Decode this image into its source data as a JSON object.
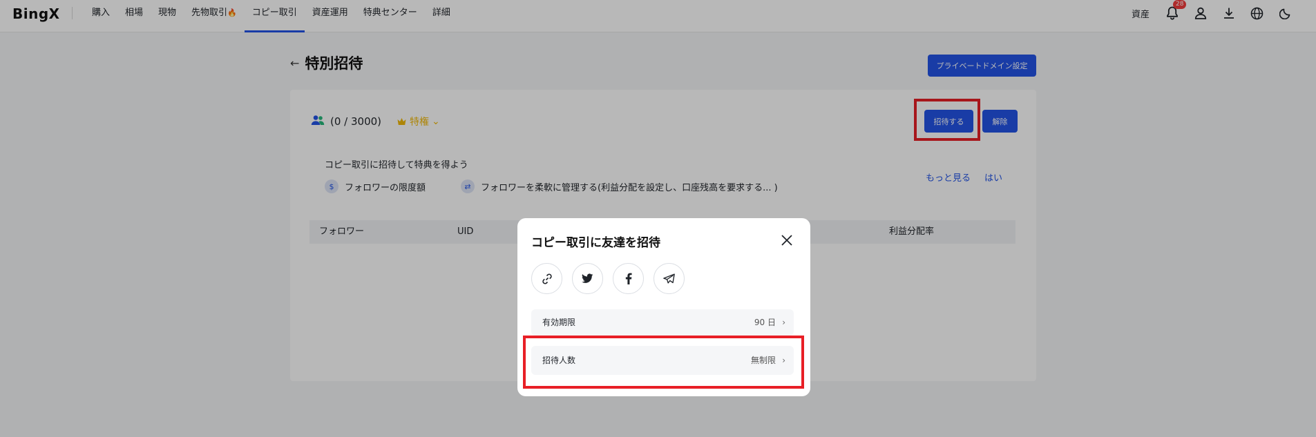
{
  "header": {
    "logo_text": "BingX",
    "nav": [
      {
        "label": "購入"
      },
      {
        "label": "相場"
      },
      {
        "label": "現物"
      },
      {
        "label": "先物取引"
      },
      {
        "label": "コピー取引",
        "active": true
      },
      {
        "label": "資産運用"
      },
      {
        "label": "特典センター"
      },
      {
        "label": "詳細"
      }
    ],
    "assets_label": "資産",
    "notification_count": "28",
    "icons": [
      "bell-icon",
      "user-icon",
      "download-icon",
      "globe-icon",
      "moon-icon"
    ]
  },
  "page": {
    "title": "特別招待",
    "domain_button": "プライベートドメイン設定",
    "count_text": "(0 / 3000)",
    "privilege_label": "特権",
    "invite_button": "招待する",
    "release_button": "解除",
    "promo_title": "コピー取引に招待して特典を得よう",
    "features": [
      {
        "icon": "dollar-icon",
        "text": "フォロワーの限度額"
      },
      {
        "icon": "swap-icon",
        "text": "フォロワーを柔軟に管理する(利益分配を設定し、口座残高を要求する... )"
      }
    ],
    "more_link": "もっと見る",
    "yes_link": "はい",
    "table_headers": [
      "フォロワー",
      "UID",
      "利益分配率"
    ]
  },
  "modal": {
    "title": "コピー取引に友達を招待",
    "share_icons": [
      "link-icon",
      "twitter-icon",
      "facebook-icon",
      "telegram-icon"
    ],
    "rows": [
      {
        "label": "有効期限",
        "value": "90 日"
      },
      {
        "label": "招待人数",
        "value": "無制限"
      }
    ]
  },
  "colors": {
    "accent": "#2354e6",
    "highlight": "#e81f26",
    "privilege": "#f0b90b"
  }
}
